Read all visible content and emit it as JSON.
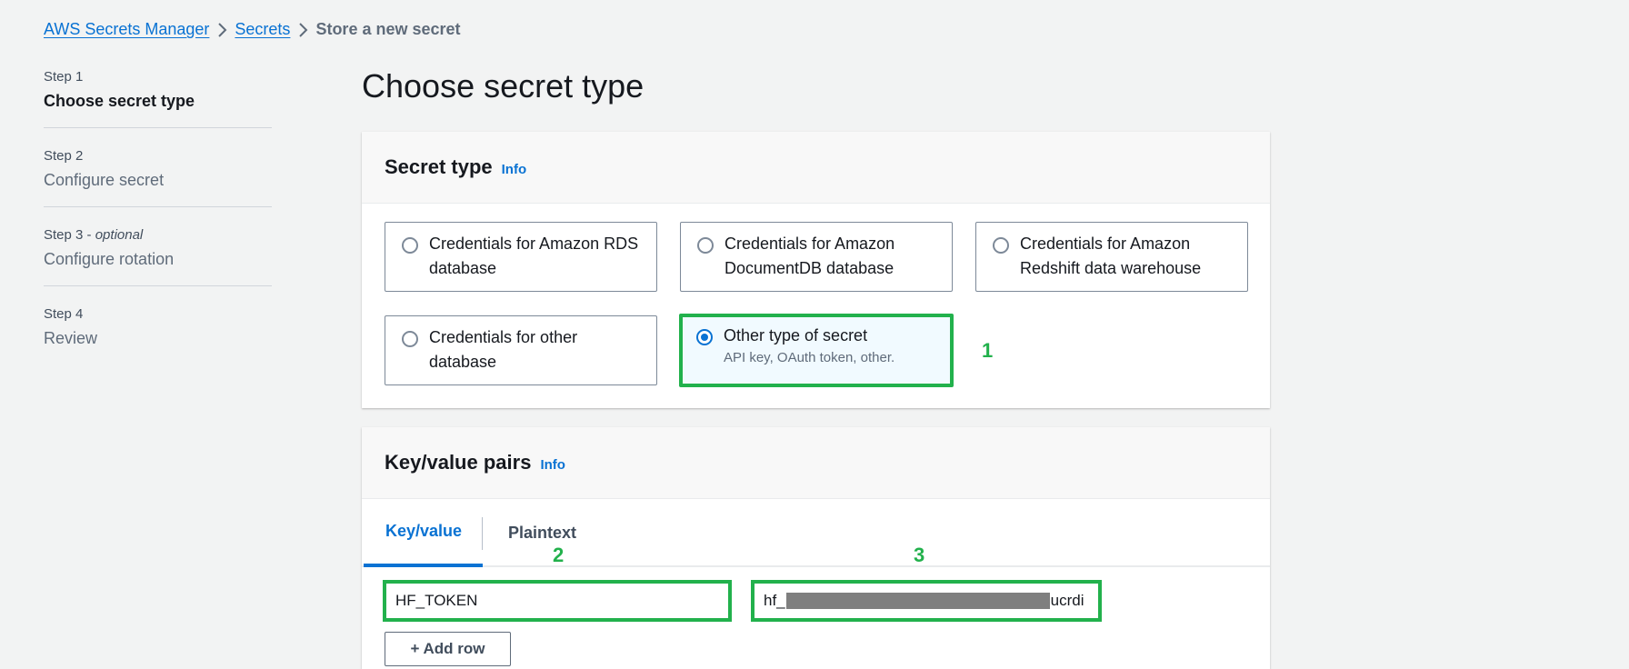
{
  "breadcrumb": {
    "items": [
      "AWS Secrets Manager",
      "Secrets"
    ],
    "current": "Store a new secret"
  },
  "steps": [
    {
      "num": "Step 1",
      "optional": "",
      "title": "Choose secret type"
    },
    {
      "num": "Step 2",
      "optional": "",
      "title": "Configure secret"
    },
    {
      "num": "Step 3",
      "optional": "optional",
      "title": "Configure rotation"
    },
    {
      "num": "Step 4",
      "optional": "",
      "title": "Review"
    }
  ],
  "page_title": "Choose secret type",
  "secret_type": {
    "heading": "Secret type",
    "info": "Info",
    "options": [
      {
        "label": "Credentials for Amazon RDS database",
        "desc": "",
        "selected": false
      },
      {
        "label": "Credentials for Amazon DocumentDB database",
        "desc": "",
        "selected": false
      },
      {
        "label": "Credentials for Amazon Redshift data warehouse",
        "desc": "",
        "selected": false
      },
      {
        "label": "Credentials for other database",
        "desc": "",
        "selected": false
      },
      {
        "label": "Other type of secret",
        "desc": "API key, OAuth token, other.",
        "selected": true
      }
    ]
  },
  "annotations": {
    "a1": "1",
    "a2": "2",
    "a3": "3"
  },
  "kv": {
    "heading": "Key/value pairs",
    "info": "Info",
    "tabs": [
      {
        "label": "Key/value",
        "active": true
      },
      {
        "label": "Plaintext",
        "active": false
      }
    ],
    "key_value": "HF_TOKEN",
    "value_prefix": "hf_",
    "value_suffix": "ucrdi",
    "add_row": "+ Add row"
  },
  "colors": {
    "accent": "#0972d3",
    "annotation": "#22b14c",
    "background": "#f2f3f3"
  }
}
